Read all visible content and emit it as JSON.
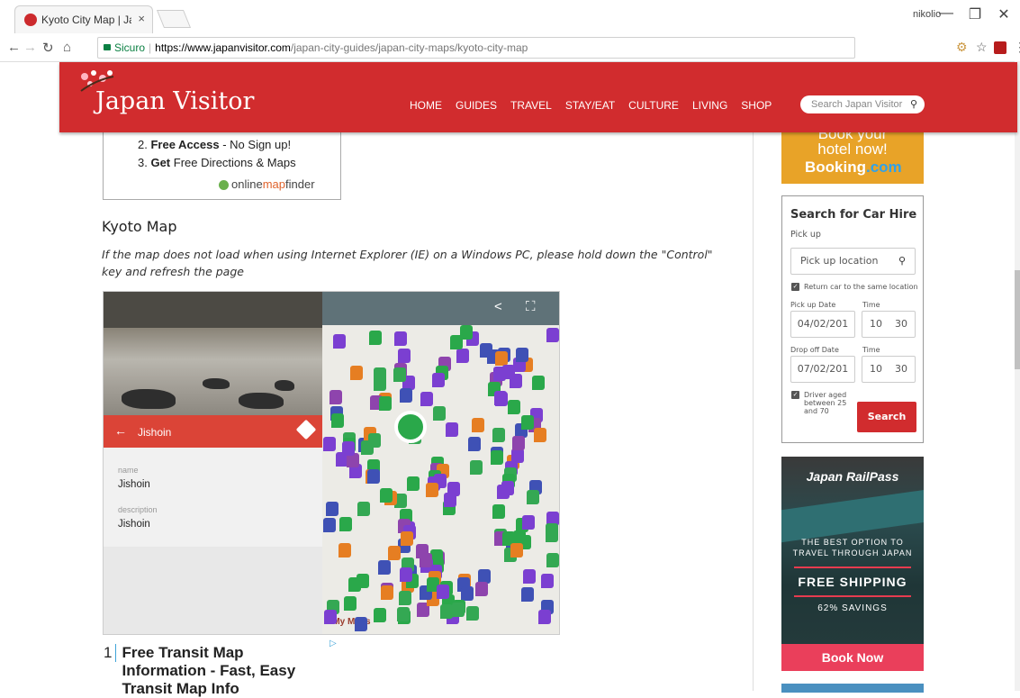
{
  "browser": {
    "tab_title": "Kyoto City Map | JapanVi",
    "tab_close": "×",
    "user": "nikolio",
    "min": "—",
    "restore": "❐",
    "close": "✕",
    "secure_label": "Sicuro",
    "url_host": "https://www.japanvisitor.com",
    "url_path": "/japan-city-guides/japan-city-maps/kyoto-city-map"
  },
  "header": {
    "logo": "Japan Visitor",
    "nav": [
      "HOME",
      "GUIDES",
      "TRAVEL",
      "STAY/EAT",
      "CULTURE",
      "LIVING",
      "SHOP"
    ],
    "search_placeholder": "Search Japan Visitor"
  },
  "ad_top": {
    "line2_bold": "Free Access",
    "line2_rest": " - No Sign up!",
    "line3_bold": "Get",
    "line3_rest": " Free Directions & Maps",
    "n2": "2.",
    "n3": "3.",
    "brand_a": "online",
    "brand_b": "map",
    "brand_c": "finder"
  },
  "main": {
    "heading": "Kyoto Map",
    "note": "If the map does not load when using Internet Explorer (IE) on a Windows PC, please hold down the \"Control\" key and refresh the page"
  },
  "map": {
    "place_name": "Jishoin",
    "name_key": "name",
    "name_val": "Jishoin",
    "desc_key": "description",
    "desc_val": "Jishoin",
    "footer": "e My Maps"
  },
  "ad_bottom": {
    "num": "1",
    "text": "Free Transit Map Information - Fast, Easy Transit Map Info"
  },
  "sidebar": {
    "booking_line1": "Book your",
    "booking_line2": "hotel now!",
    "booking_brand_a": "Booking",
    "booking_brand_b": ".com",
    "car_title": "Search for Car Hire",
    "pickup_label": "Pick up",
    "pickup_placeholder": "Pick up location",
    "return_same": "Return car to the same location",
    "pickup_date_label": "Pick up Date",
    "time_label": "Time",
    "pickup_date": "04/02/201",
    "pickup_hour": "10",
    "pickup_min": "30",
    "dropoff_date_label": "Drop off Date",
    "dropoff_date": "07/02/201",
    "dropoff_hour": "10",
    "dropoff_min": "30",
    "driver_age": "Driver aged between 25 and 70",
    "search_btn": "Search",
    "rail_brand": "Japan RailPass",
    "rail_tag1": "THE BEST OPTION TO",
    "rail_tag2": "TRAVEL THROUGH JAPAN",
    "rail_shipping": "FREE SHIPPING",
    "rail_savings": "62% SAVINGS",
    "rail_btn": "Book Now"
  }
}
